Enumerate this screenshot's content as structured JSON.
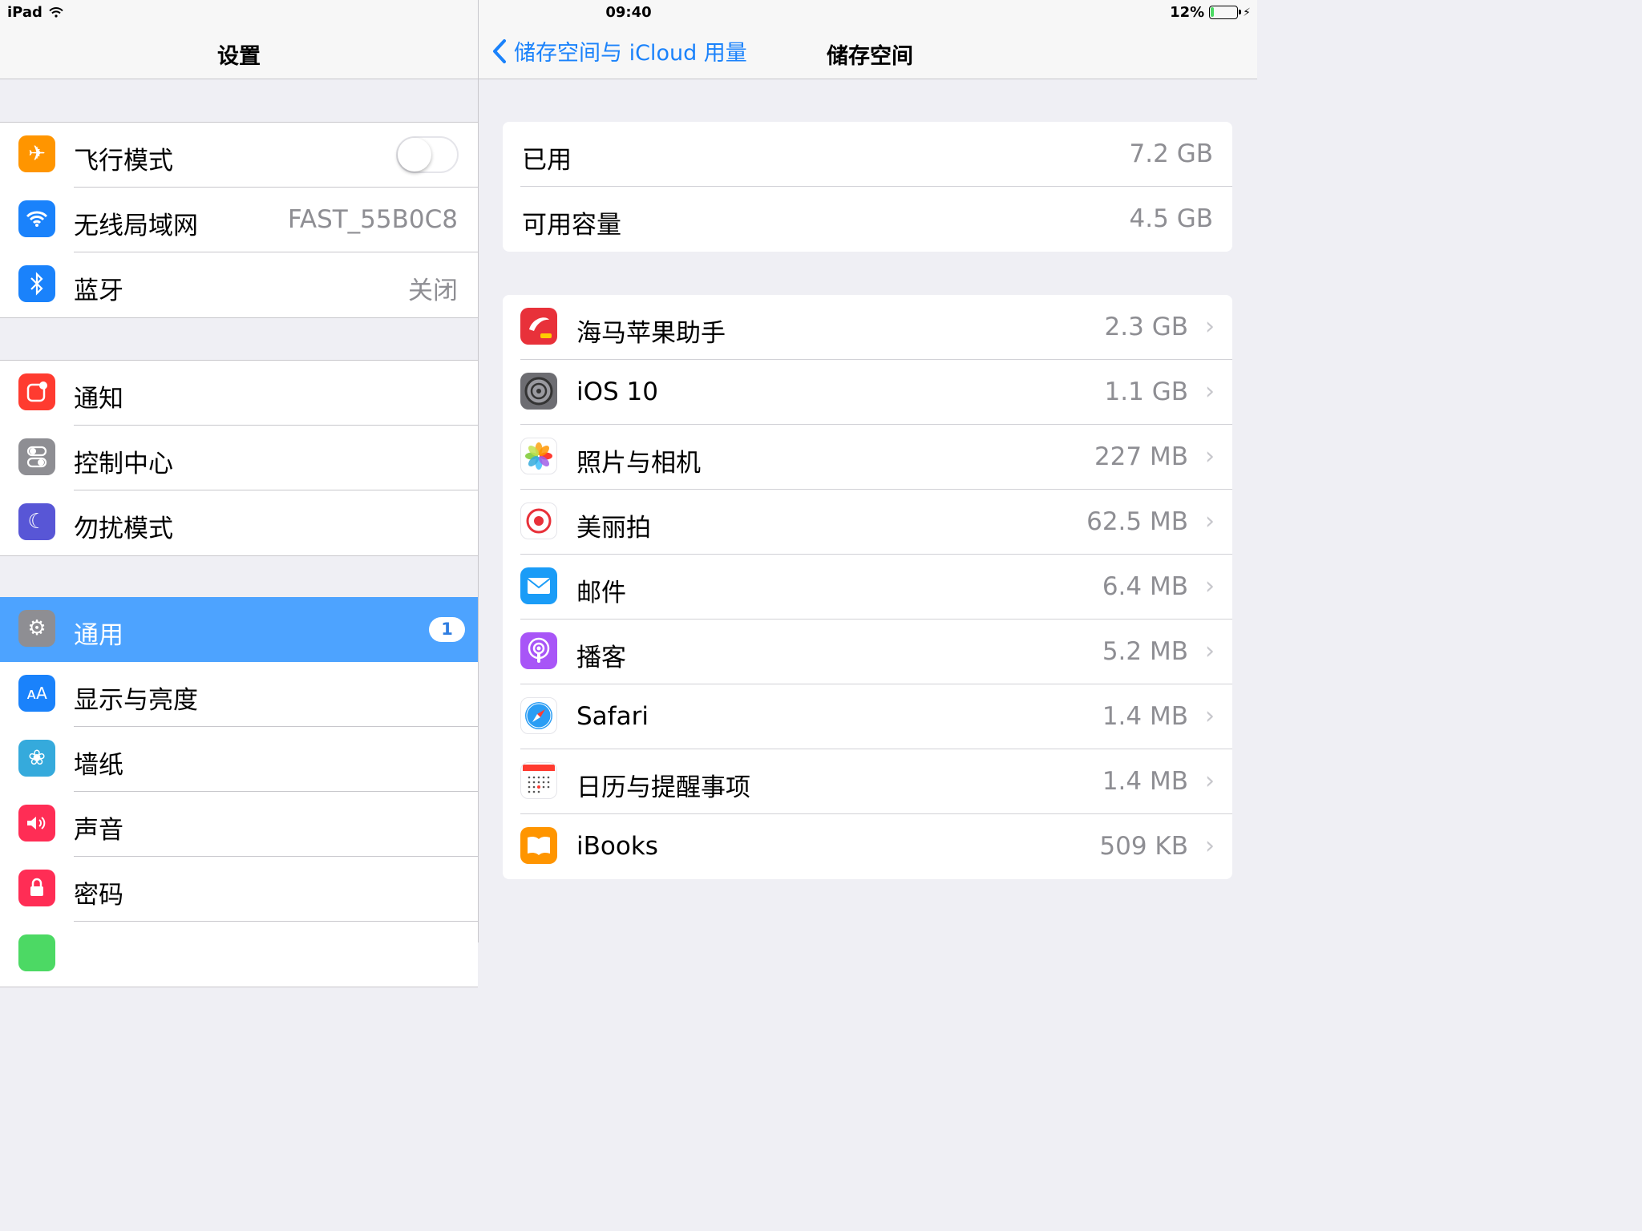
{
  "status_bar": {
    "device": "iPad",
    "time": "09:40",
    "battery": "12%",
    "battery_level": 0.12
  },
  "master": {
    "title": "设置",
    "groups": [
      [
        {
          "label": "飞行模式",
          "icon": "airplane-icon",
          "color": "#ff9500",
          "toggle": "off"
        },
        {
          "label": "无线局域网",
          "icon": "wifi-icon",
          "color": "#1a82fb",
          "value": "FAST_55B0C8"
        },
        {
          "label": "蓝牙",
          "icon": "bluetooth-icon",
          "color": "#1a82fb",
          "value": "关闭"
        }
      ],
      [
        {
          "label": "通知",
          "icon": "notifications-icon",
          "color": "#ff3b30"
        },
        {
          "label": "控制中心",
          "icon": "control-center-icon",
          "color": "#8e8e93"
        },
        {
          "label": "勿扰模式",
          "icon": "moon-icon",
          "color": "#5856d6"
        }
      ],
      [
        {
          "label": "通用",
          "icon": "gear-icon",
          "color": "#8e8e93",
          "badge": "1",
          "selected": true
        },
        {
          "label": "显示与亮度",
          "icon": "text-size-icon",
          "color": "#1a82fb"
        },
        {
          "label": "墙纸",
          "icon": "flower-icon",
          "color": "#35aadc"
        },
        {
          "label": "声音",
          "icon": "speaker-icon",
          "color": "#ff2d55"
        },
        {
          "label": "密码",
          "icon": "lock-icon",
          "color": "#ff2d55"
        }
      ]
    ]
  },
  "detail": {
    "back_label": "储存空间与 iCloud 用量",
    "title": "储存空间",
    "summary": [
      {
        "label": "已用",
        "value": "7.2 GB"
      },
      {
        "label": "可用容量",
        "value": "4.5 GB"
      }
    ],
    "apps": [
      {
        "label": "海马苹果助手",
        "value": "2.3 GB",
        "icon": "haima-app-icon",
        "color": "#e8313a"
      },
      {
        "label": "iOS 10",
        "value": "1.1 GB",
        "icon": "ios-settings-icon",
        "color": "#6d6d72"
      },
      {
        "label": "照片与相机",
        "value": "227 MB",
        "icon": "photos-icon",
        "color": "#ffffff"
      },
      {
        "label": "美丽拍",
        "value": "62.5 MB",
        "icon": "meilipai-icon",
        "color": "#ffffff"
      },
      {
        "label": "邮件",
        "value": "6.4 MB",
        "icon": "mail-icon",
        "color": "#1a9cf7"
      },
      {
        "label": "播客",
        "value": "5.2 MB",
        "icon": "podcasts-icon",
        "color": "#a855f7"
      },
      {
        "label": "Safari",
        "value": "1.4 MB",
        "icon": "safari-icon",
        "color": "#ffffff"
      },
      {
        "label": "日历与提醒事项",
        "value": "1.4 MB",
        "icon": "calendar-icon",
        "color": "#ffffff"
      },
      {
        "label": "iBooks",
        "value": "509 KB",
        "icon": "ibooks-icon",
        "color": "#ff9500"
      }
    ]
  }
}
